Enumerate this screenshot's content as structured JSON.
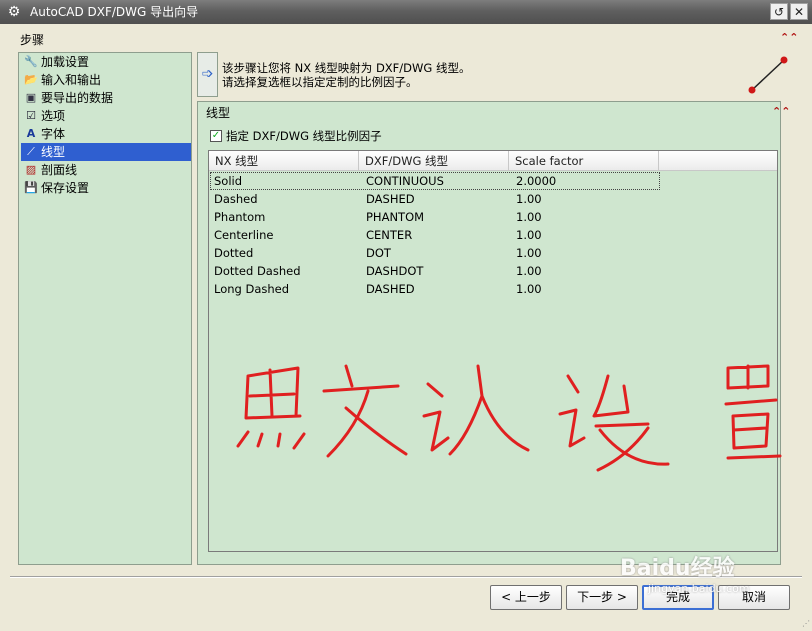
{
  "window": {
    "title": "AutoCAD DXF/DWG 导出向导"
  },
  "steps": {
    "heading": "步骤",
    "items": [
      {
        "label": "加载设置",
        "icon": "wrench-icon"
      },
      {
        "label": "输入和输出",
        "icon": "folder-open-icon"
      },
      {
        "label": "要导出的数据",
        "icon": "window-icon"
      },
      {
        "label": "选项",
        "icon": "checklist-icon"
      },
      {
        "label": "字体",
        "icon": "font-icon"
      },
      {
        "label": "线型",
        "icon": "line-icon"
      },
      {
        "label": "剖面线",
        "icon": "hatch-icon"
      },
      {
        "label": "保存设置",
        "icon": "save-icon"
      }
    ],
    "selected": "线型"
  },
  "info": {
    "line1": "该步骤让您将 NX 线型映射为 DXF/DWG 线型。",
    "line2": "请选择复选框以指定定制的比例因子。"
  },
  "linetype_section": {
    "heading": "线型",
    "checkbox_label": "指定 DXF/DWG 线型比例因子",
    "checkbox_checked": true,
    "columns": [
      "NX 线型",
      "DXF/DWG 线型",
      "Scale factor"
    ],
    "rows": [
      [
        "Solid",
        "CONTINUOUS",
        "2.0000"
      ],
      [
        "Dashed",
        "DASHED",
        "1.00"
      ],
      [
        "Phantom",
        "PHANTOM",
        "1.00"
      ],
      [
        "Centerline",
        "CENTER",
        "1.00"
      ],
      [
        "Dotted",
        "DOT",
        "1.00"
      ],
      [
        "Dotted Dashed",
        "DASHDOT",
        "1.00"
      ],
      [
        "Long Dashed",
        "DASHED",
        "1.00"
      ]
    ]
  },
  "buttons": {
    "back": "< 上一步",
    "next": "下一步 >",
    "finish": "完成",
    "cancel": "取消"
  },
  "overlay": {
    "watermark": "Baidu经验",
    "watermark_url": "jingyan.baidu.com"
  },
  "colors": {
    "panel_green": "#cfe6cf",
    "selection_blue": "#2f5fd0",
    "accent_red": "#b01010"
  }
}
